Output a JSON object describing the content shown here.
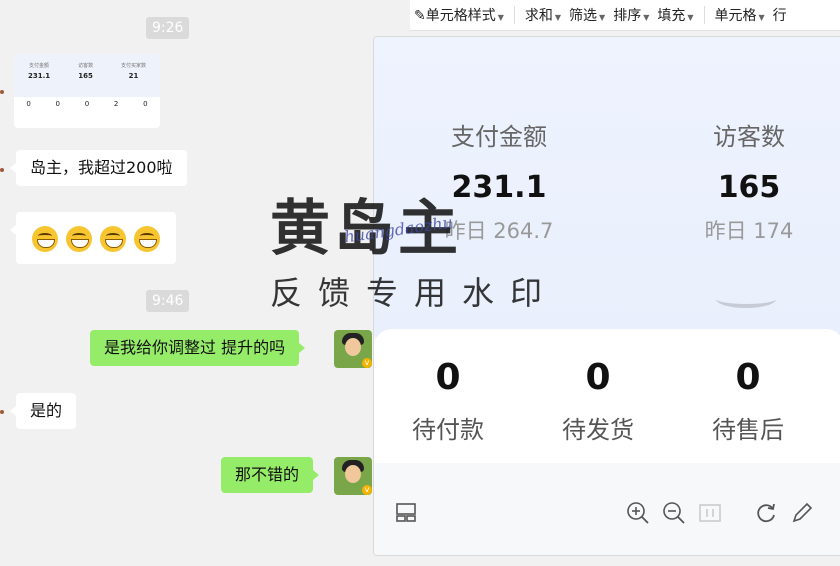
{
  "chat": {
    "times": [
      "9:26",
      "9:46"
    ],
    "thumbnail": {
      "metrics": [
        {
          "label": "支付金额",
          "value": "231.1"
        },
        {
          "label": "访客数",
          "value": "165"
        },
        {
          "label": "支付买家数",
          "value": "21"
        }
      ],
      "orders": [
        "0",
        "0",
        "0",
        "2",
        "0"
      ]
    },
    "messages": [
      {
        "side": "other",
        "text": "岛主，我超过200啦"
      },
      {
        "side": "me",
        "text": "是我给你调整过 提升的吗"
      },
      {
        "side": "other",
        "text": "是的"
      },
      {
        "side": "me",
        "text": "那不错的"
      }
    ],
    "emoji_count": 4
  },
  "toolbar": {
    "items": [
      {
        "label": "单元格样式"
      },
      {
        "label": "求和"
      },
      {
        "label": "筛选"
      },
      {
        "label": "排序"
      },
      {
        "label": "填充"
      },
      {
        "label": "单元格"
      },
      {
        "label": "行"
      }
    ]
  },
  "viewer": {
    "metrics": [
      {
        "label": "支付金额",
        "value": "231.1",
        "prev": "昨日 264.7"
      },
      {
        "label": "访客数",
        "value": "165",
        "prev": "昨日 174"
      }
    ],
    "orders": [
      {
        "value": "0",
        "label": "待付款"
      },
      {
        "value": "0",
        "label": "待发货"
      },
      {
        "value": "0",
        "label": "待售后"
      }
    ],
    "icons": [
      "layout-icon",
      "zoom-in-icon",
      "zoom-out-icon",
      "actual-size-icon",
      "rotate-icon",
      "edit-icon"
    ]
  },
  "watermark": {
    "title": "黄岛主",
    "subtitle": "反馈专用水印",
    "script": "huangdaozhu"
  }
}
